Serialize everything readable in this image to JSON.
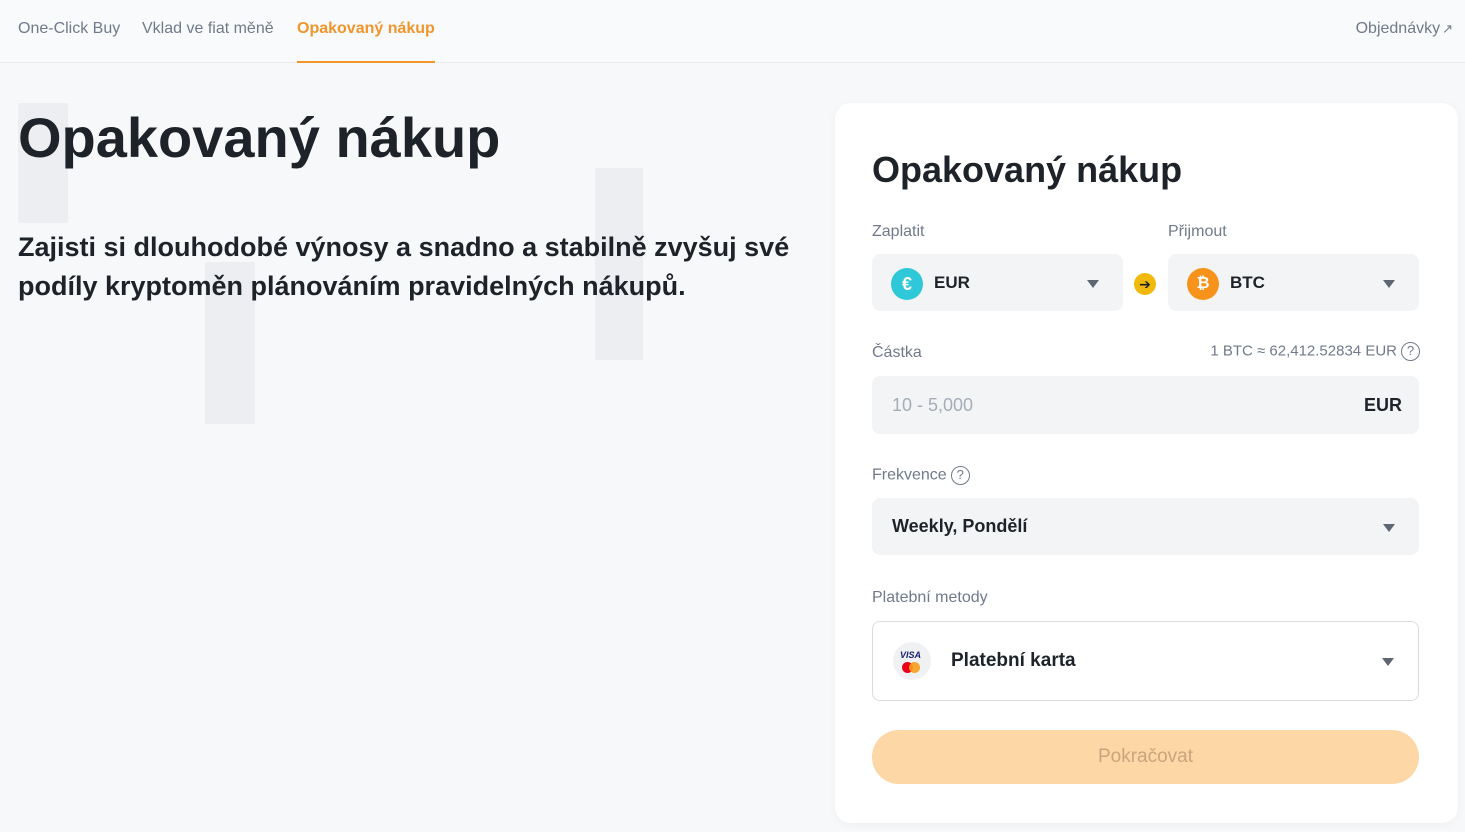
{
  "nav": {
    "tabs": [
      {
        "label": "One-Click Buy"
      },
      {
        "label": "Vklad ve fiat měně"
      },
      {
        "label": "Opakovaný nákup"
      }
    ],
    "orders_label": "Objednávky",
    "orders_icon": "external-link-icon"
  },
  "hero": {
    "title": "Opakovaný nákup",
    "description": "Zajisti si dlouhodobé výnosy a snadno a stabilně zvyšuj své podíly kryptoměn plánováním pravidelných nákupů."
  },
  "form": {
    "title": "Opakovaný nákup",
    "pay_label": "Zaplatit",
    "receive_label": "Přijmout",
    "pay_currency": {
      "symbol": "€",
      "code": "EUR",
      "icon": "euro-icon"
    },
    "receive_currency": {
      "symbol": "₿",
      "code": "BTC",
      "icon": "bitcoin-icon"
    },
    "amount_label": "Částka",
    "rate_text": "1 BTC ≈ 62,412.52834 EUR",
    "amount_placeholder": "10 - 5,000",
    "amount_unit": "EUR",
    "frequency_label": "Frekvence",
    "frequency_value": "Weekly, Pondělí",
    "payment_label": "Platební metody",
    "payment_value": "Platební karta",
    "payment_icon_text": "VISA",
    "continue_label": "Pokračovat",
    "help_symbol": "?"
  },
  "colors": {
    "accent": "#f0952c",
    "button_disabled": "#fdd7a6",
    "eur": "#2ec8d8",
    "btc": "#f7931a"
  }
}
